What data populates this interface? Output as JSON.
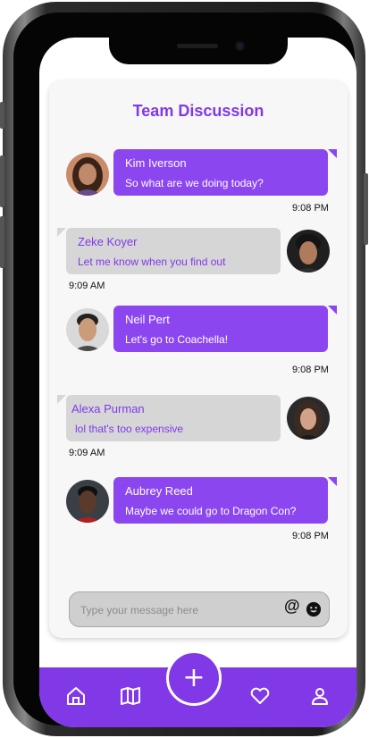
{
  "chat": {
    "title": "Team Discussion",
    "messages": [
      {
        "sender": "Kim Iverson",
        "text": "So what are we doing today?",
        "time": "9:08 PM",
        "direction": "outgoing"
      },
      {
        "sender": "Zeke Koyer",
        "text": "Let me know when you find out",
        "time": "9:09 AM",
        "direction": "incoming"
      },
      {
        "sender": "Neil Pert",
        "text": "Let's go to Coachella!",
        "time": "9:08 PM",
        "direction": "outgoing"
      },
      {
        "sender": "Alexa Purman",
        "text": "lol that's too expensive",
        "time": "9:09 AM",
        "direction": "incoming"
      },
      {
        "sender": "Aubrey Reed",
        "text": "Maybe we could go to Dragon Con?",
        "time": "9:08 PM",
        "direction": "outgoing"
      }
    ]
  },
  "composer": {
    "placeholder": "Type your message here",
    "mention_symbol": "@",
    "icons": [
      "at-icon",
      "emoji-icon"
    ]
  },
  "fab": {
    "symbol": "+",
    "icon": "plus-icon"
  },
  "navbar": {
    "items": [
      "home-icon",
      "book-icon",
      "heart-icon",
      "user-icon"
    ]
  },
  "colors": {
    "accent": "#8139e8",
    "bubble_out": "#8b46f0",
    "bubble_in": "#d6d6d6",
    "card": "#f7f7f7"
  }
}
